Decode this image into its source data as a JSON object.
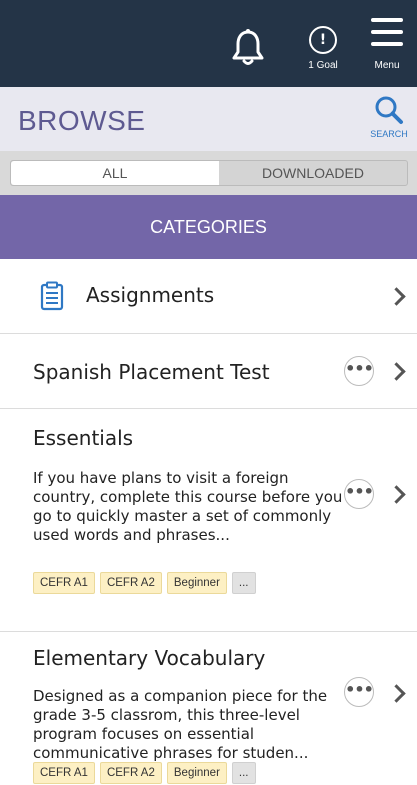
{
  "header": {
    "goal_icon_text": "!",
    "goal_label": "1 Goal",
    "menu_label": "Menu"
  },
  "browse": {
    "title": "BROWSE",
    "search_label": "SEARCH"
  },
  "tabs": {
    "all": "ALL",
    "downloaded": "DOWNLOADED",
    "selected": "ALL"
  },
  "categories_header": "CATEGORIES",
  "more_glyph": "•••",
  "items": [
    {
      "title": "Assignments"
    },
    {
      "title": "Spanish Placement Test"
    },
    {
      "title": "Essentials",
      "description": "If you have plans to visit a foreign country, complete this course before you go to quickly master a set of commonly used words and phrases...",
      "tags": [
        "CEFR A1",
        "CEFR A2",
        "Beginner",
        "..."
      ]
    },
    {
      "title": "Elementary Vocabulary",
      "description": "Designed as a companion piece for the grade 3-5 classrom, this three-level program focuses on essential communicative phrases for studen...",
      "tags": [
        "CEFR A1",
        "CEFR A2",
        "Beginner",
        "..."
      ]
    }
  ],
  "colors": {
    "topbar": "#243447",
    "browse_title": "#5e5a91",
    "category_header": "#7366a8",
    "search_icon": "#2f78c4",
    "tag_bg": "#fdf0c4"
  }
}
